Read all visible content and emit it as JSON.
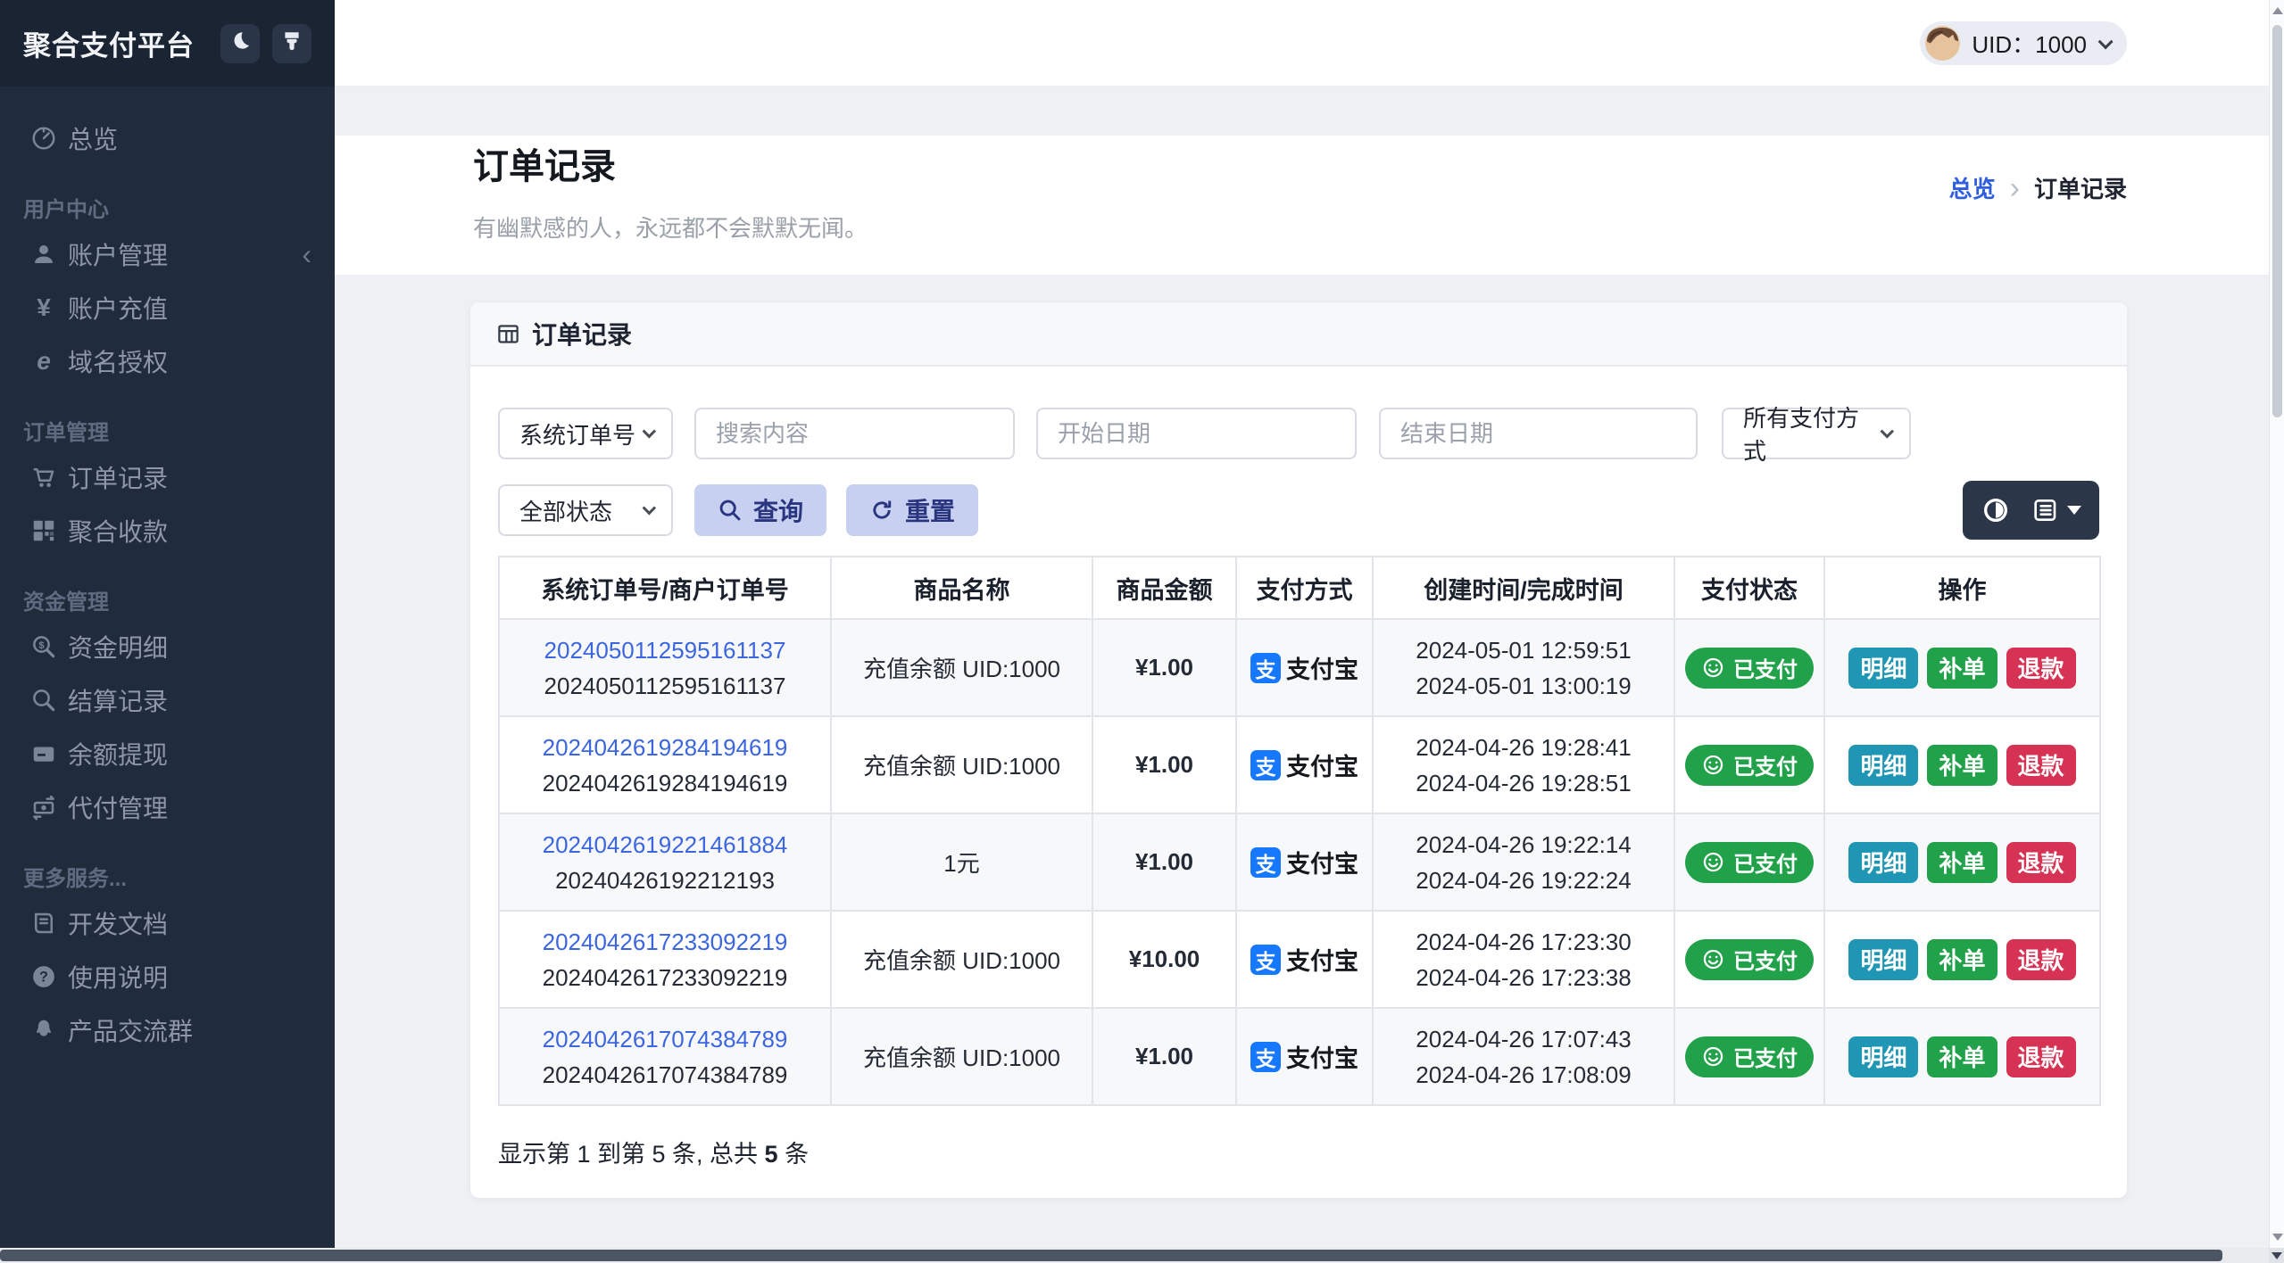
{
  "app": {
    "brand": "聚合支付平台"
  },
  "topbar": {
    "uid_label": "UID：1000"
  },
  "sidebar": {
    "overview_label": "总览",
    "sections": [
      {
        "title": "用户中心",
        "items": [
          {
            "label": "账户管理"
          },
          {
            "label": "账户充值"
          },
          {
            "label": "域名授权"
          }
        ]
      },
      {
        "title": "订单管理",
        "items": [
          {
            "label": "订单记录"
          },
          {
            "label": "聚合收款"
          }
        ]
      },
      {
        "title": "资金管理",
        "items": [
          {
            "label": "资金明细"
          },
          {
            "label": "结算记录"
          },
          {
            "label": "余额提现"
          },
          {
            "label": "代付管理"
          }
        ]
      },
      {
        "title": "更多服务...",
        "items": [
          {
            "label": "开发文档"
          },
          {
            "label": "使用说明"
          },
          {
            "label": "产品交流群"
          }
        ]
      }
    ]
  },
  "page": {
    "title": "订单记录",
    "subtitle": "有幽默感的人，永远都不会默默无闻。",
    "breadcrumb": {
      "home": "总览",
      "separator": "›",
      "current": "订单记录"
    }
  },
  "card": {
    "header_title": "订单记录"
  },
  "filters": {
    "search_type": "系统订单号",
    "search_placeholder": "搜索内容",
    "start_date_placeholder": "开始日期",
    "end_date_placeholder": "结束日期",
    "pay_method": "所有支付方式",
    "status": "全部状态",
    "query_label": "查询",
    "reset_label": "重置"
  },
  "table": {
    "headers": [
      "系统订单号/商户订单号",
      "商品名称",
      "商品金额",
      "支付方式",
      "创建时间/完成时间",
      "支付状态",
      "操作"
    ],
    "actions": {
      "detail": "明细",
      "supplement": "补单",
      "refund": "退款"
    },
    "alipay_glyph": "支",
    "rows": [
      {
        "sys_no": "2024050112595161137",
        "mch_no": "2024050112595161137",
        "product": "充值余额 UID:1000",
        "amount": "¥1.00",
        "pay_method": "支付宝",
        "created": "2024-05-01 12:59:51",
        "completed": "2024-05-01 13:00:19",
        "status": "已支付"
      },
      {
        "sys_no": "2024042619284194619",
        "mch_no": "2024042619284194619",
        "product": "充值余额 UID:1000",
        "amount": "¥1.00",
        "pay_method": "支付宝",
        "created": "2024-04-26 19:28:41",
        "completed": "2024-04-26 19:28:51",
        "status": "已支付"
      },
      {
        "sys_no": "2024042619221461884",
        "mch_no": "20240426192212193",
        "product": "1元",
        "amount": "¥1.00",
        "pay_method": "支付宝",
        "created": "2024-04-26 19:22:14",
        "completed": "2024-04-26 19:22:24",
        "status": "已支付"
      },
      {
        "sys_no": "2024042617233092219",
        "mch_no": "2024042617233092219",
        "product": "充值余额 UID:1000",
        "amount": "¥10.00",
        "pay_method": "支付宝",
        "created": "2024-04-26 17:23:30",
        "completed": "2024-04-26 17:23:38",
        "status": "已支付"
      },
      {
        "sys_no": "2024042617074384789",
        "mch_no": "2024042617074384789",
        "product": "充值余额 UID:1000",
        "amount": "¥1.00",
        "pay_method": "支付宝",
        "created": "2024-04-26 17:07:43",
        "completed": "2024-04-26 17:08:09",
        "status": "已支付"
      }
    ],
    "footer": {
      "prefix": "显示第 1 到第 5 条, 总共 ",
      "total": "5",
      "suffix": " 条"
    }
  },
  "icons": [
    "moon-icon",
    "paintbrush-icon",
    "gauge-icon",
    "user-icon",
    "yen-icon",
    "globe-e-icon",
    "cart-icon",
    "qrcode-icon",
    "search-dollar-icon",
    "search-icon",
    "bank-card-icon",
    "money-transfer-icon",
    "book-icon",
    "question-circle-icon",
    "qq-penguin-icon",
    "table-icon",
    "contrast-toggle-icon",
    "table-columns-icon",
    "magnifier-icon",
    "refresh-icon",
    "smiley-icon",
    "alipay-icon",
    "chevron-down-icon",
    "chevron-left-icon"
  ],
  "colors": {
    "sidebar_bg": "#202b3b",
    "sidebar_header_bg": "#1a2432",
    "accent_blue": "#2f5fe0",
    "link_blue": "#3c66e0",
    "alipay_blue": "#1677ff",
    "success_green": "#21a149",
    "teal": "#1e96b4",
    "danger_red": "#d63253",
    "soft_button_bg": "#c8d0f1",
    "soft_button_text": "#2a3580",
    "dark_toolbar_bg": "#2b3648",
    "content_bg": "#eef0f4"
  }
}
